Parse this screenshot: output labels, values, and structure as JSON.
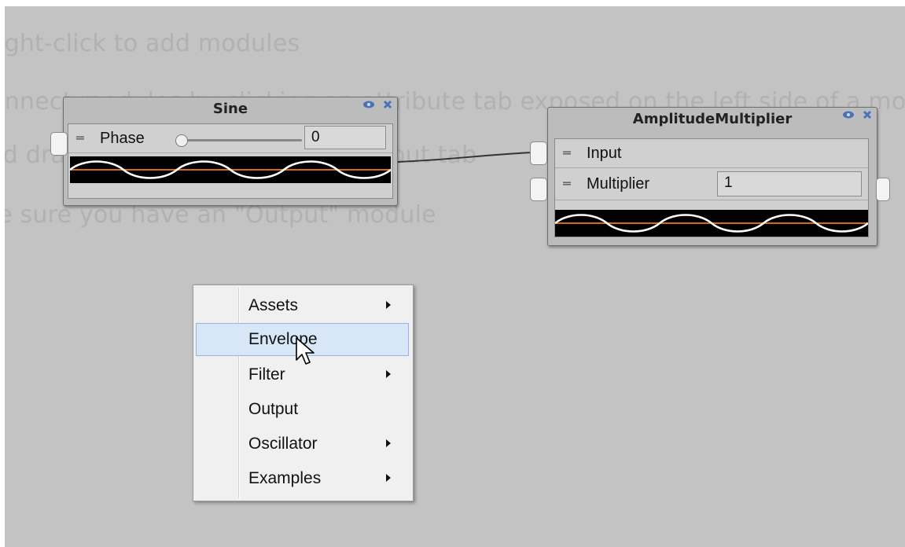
{
  "hints": [
    "Right-click to add modules",
    "Connect modules by clicking an attribute tab exposed on the left side of a module",
    "and dragging to the right-hand output tab",
    "Make sure you have an \"Output\" module"
  ],
  "sine_node": {
    "title": "Sine",
    "phase_label": "Phase",
    "phase_value": "0"
  },
  "amp_node": {
    "title": "AmplitudeMultiplier",
    "input_label": "Input",
    "multiplier_label": "Multiplier",
    "multiplier_value": "1"
  },
  "context_menu": {
    "items": [
      {
        "label": "Assets",
        "submenu": true
      },
      {
        "label": "Envelope",
        "submenu": false,
        "highlighted": true
      },
      {
        "label": "Filter",
        "submenu": true
      },
      {
        "label": "Output",
        "submenu": false
      },
      {
        "label": "Oscillator",
        "submenu": true
      },
      {
        "label": "Examples",
        "submenu": true
      }
    ]
  },
  "colors": {
    "canvas": "#c3c3c3",
    "wave_line": "#ffffff",
    "wave_baseline": "#d2691e",
    "menu_highlight": "#d7e7f7"
  },
  "icons": [
    "eye-icon",
    "close-icon",
    "grip-icon",
    "submenu-arrow-icon",
    "pointer-cursor-icon"
  ]
}
